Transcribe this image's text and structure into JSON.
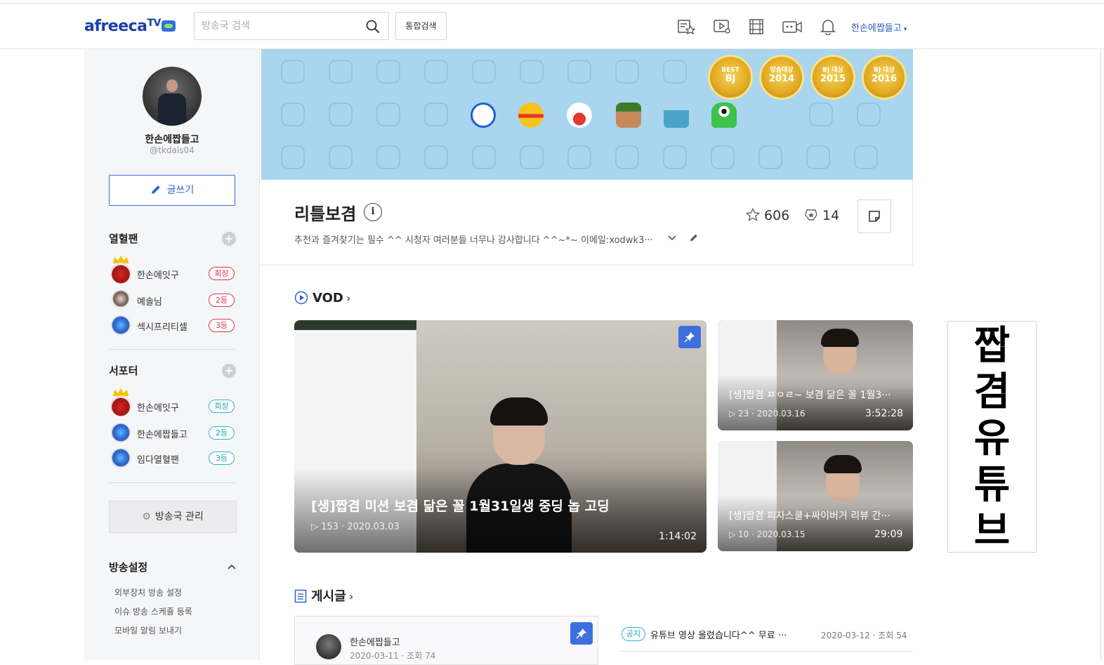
{
  "header": {
    "logo": "afreecaTV",
    "search_placeholder": "방송국 검색",
    "total_search_label": "통합검색",
    "user_name": "한손에짭들고"
  },
  "sidebar": {
    "profile_name": "한손에짭들고",
    "profile_id": "@tkdals04",
    "write_label": "글쓰기",
    "fans_title": "열혈팬",
    "fans": [
      {
        "name": "한손에잇구",
        "rank": "회장"
      },
      {
        "name": "예솔님",
        "rank": "2등"
      },
      {
        "name": "섹시프리티셀",
        "rank": "3등"
      }
    ],
    "supporters_title": "서포터",
    "supporters": [
      {
        "name": "한손에잇구",
        "rank": "회장"
      },
      {
        "name": "한손에짭들고",
        "rank": "2등"
      },
      {
        "name": "임다열혈팬",
        "rank": "3등"
      }
    ],
    "manage_label": "방송국 관리",
    "settings_title": "방송설정",
    "settings_items": [
      "외부장치 방송 설정",
      "이슈 방송 스케쥴 등록",
      "모바일 알림 보내기"
    ]
  },
  "banner": {
    "medals": [
      {
        "line1": "BEST",
        "line2": "BJ"
      },
      {
        "line1": "방송대상",
        "line2": "2014"
      },
      {
        "line1": "BJ 대상",
        "line2": "2015"
      },
      {
        "line1": "BJ 대상",
        "line2": "2016"
      }
    ]
  },
  "channel": {
    "title": "리틀보겸",
    "description": "추천과 즐겨찾기는 필수 ^^ 시청자 여러분들 너무나 감사합니다 ^^~*~ 이메일:xodwk3···",
    "favorites": "606",
    "subscribers": "14"
  },
  "vod": {
    "section_title": "VOD",
    "main": {
      "title": "[생]짭겸 미션 보겸 닮은 꼴 1월31일생 중딩 놉 고딩",
      "views": "153",
      "date": "2020.03.03",
      "duration": "1:14:02"
    },
    "side": [
      {
        "title": "[생]짭겸 ㅉㅇㄹ~ 보겸 닮은 꼴 1월3···",
        "views": "23",
        "date": "2020.03.16",
        "duration": "3:52:28"
      },
      {
        "title": "[생]짭겸 피자스쿨+싸이버거 리뷰 간···",
        "views": "10",
        "date": "2020.03.15",
        "duration": "29:09"
      }
    ]
  },
  "youtube_banner": [
    "짭",
    "겸",
    "유",
    "튜",
    "브"
  ],
  "posts": {
    "section_title": "게시글",
    "card": {
      "author": "한손에짭들고",
      "meta": "2020-03-11 · 조회 74"
    },
    "notice": {
      "tag": "공지",
      "title": "유튜브 영상 올렸습니다^^ 무료 ···",
      "meta": "2020-03-12 · 조회 54"
    }
  }
}
